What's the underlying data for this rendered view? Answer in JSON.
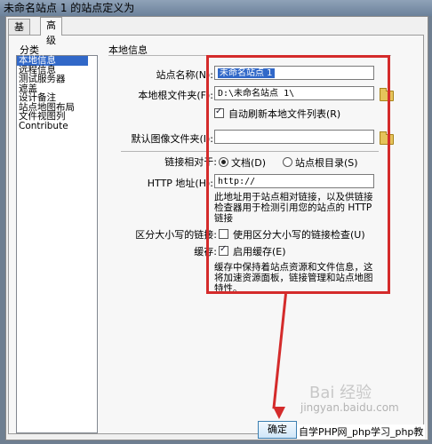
{
  "window": {
    "title": "未命名站点 1 的站点定义为"
  },
  "tabs": [
    {
      "label": "基本"
    },
    {
      "label": "高级"
    }
  ],
  "category": {
    "heading": "分类",
    "items": [
      "本地信息",
      "远程信息",
      "测试服务器",
      "遮盖",
      "设计备注",
      "站点地图布局",
      "文件视图列",
      "Contribute"
    ]
  },
  "local_info": {
    "section_title": "本地信息",
    "site_name": {
      "label": "站点名称(N):",
      "value": "未命名站点 1"
    },
    "root_folder": {
      "label": "本地根文件夹(F):",
      "value": "D:\\未命名站点 1\\"
    },
    "auto_refresh": {
      "label": "自动刷新本地文件列表(R)",
      "checked": true
    },
    "default_images": {
      "label": "默认图像文件夹(I):",
      "value": ""
    },
    "links_relative": {
      "label": "链接相对于:",
      "opt_document": "文档(D)",
      "opt_root": "站点根目录(S)",
      "selected": "document"
    },
    "http_address": {
      "label": "HTTP 地址(H):",
      "value": "http://"
    },
    "http_note": "此地址用于站点相对链接，以及供链接检查器用于检测引用您的站点的 HTTP 链接",
    "case_sensitive": {
      "label": "区分大小写的链接:",
      "option": "使用区分大小写的链接检查(U)",
      "checked": false
    },
    "cache": {
      "label": "缓存:",
      "option": "启用缓存(E)",
      "checked": true
    },
    "cache_note": "缓存中保持着站点资源和文件信息，这将加速资源面板，链接管理和站点地图特性。"
  },
  "buttons": {
    "ok": "确定"
  },
  "overlay": {
    "footer": "自学PHP网_php学习_php教",
    "watermark": "Bai 经验",
    "watermark_url": "jingyan.baidu.com"
  },
  "colors": {
    "annotation_red": "#d42b2b",
    "selection_blue": "#3168c8"
  }
}
